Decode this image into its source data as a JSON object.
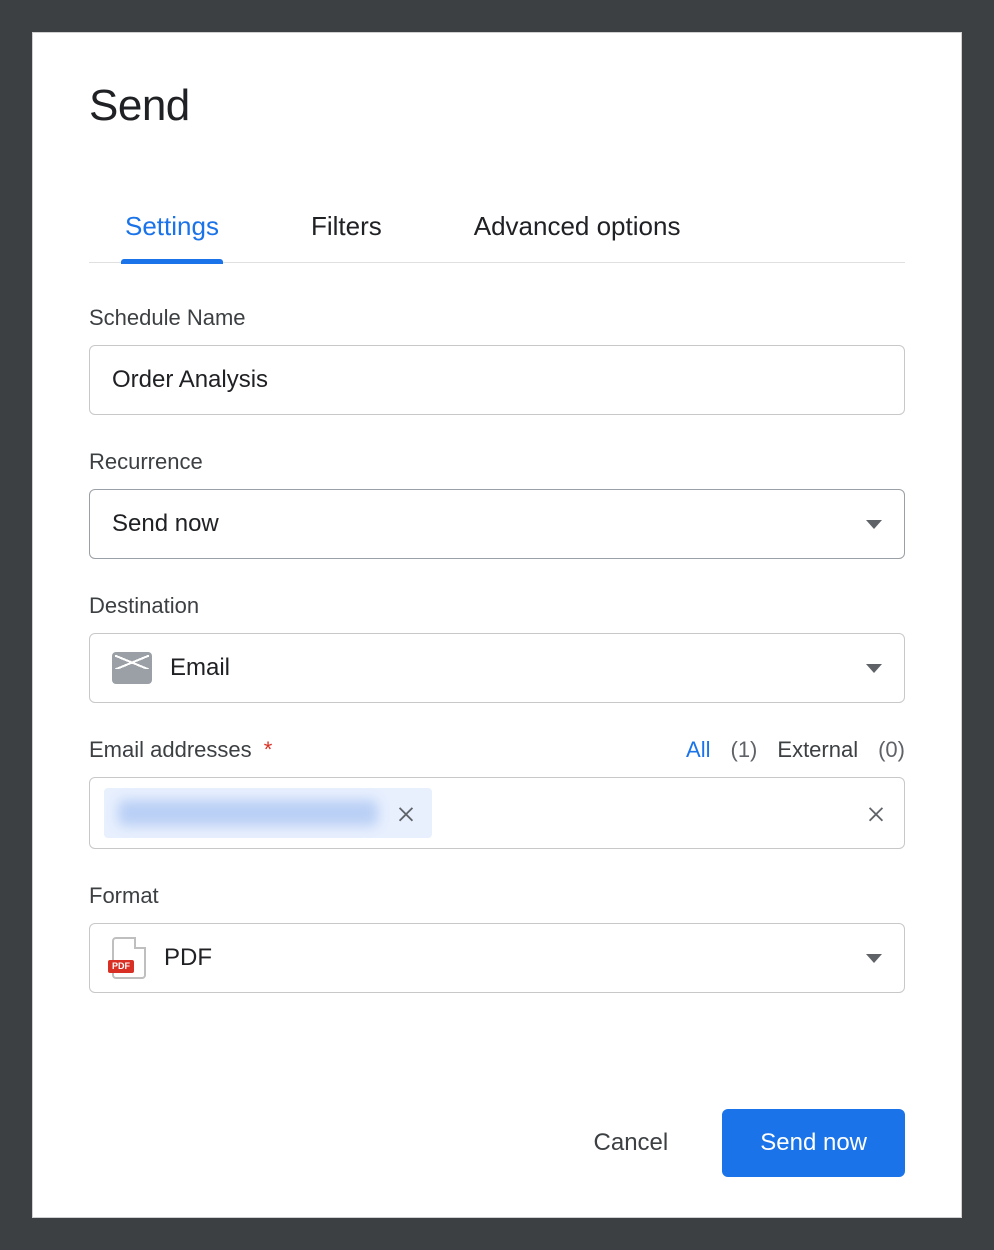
{
  "dialog": {
    "title": "Send"
  },
  "tabs": {
    "settings": "Settings",
    "filters": "Filters",
    "advanced": "Advanced options"
  },
  "fields": {
    "schedule_name": {
      "label": "Schedule Name",
      "value": "Order Analysis"
    },
    "recurrence": {
      "label": "Recurrence",
      "value": "Send now"
    },
    "destination": {
      "label": "Destination",
      "value": "Email"
    },
    "email_addresses": {
      "label": "Email addresses",
      "required_marker": "*",
      "all_label": "All",
      "all_count": "(1)",
      "external_label": "External",
      "external_count": "(0)",
      "chip_redacted": true
    },
    "format": {
      "label": "Format",
      "value": "PDF",
      "badge": "PDF"
    }
  },
  "footer": {
    "cancel": "Cancel",
    "submit": "Send now"
  }
}
